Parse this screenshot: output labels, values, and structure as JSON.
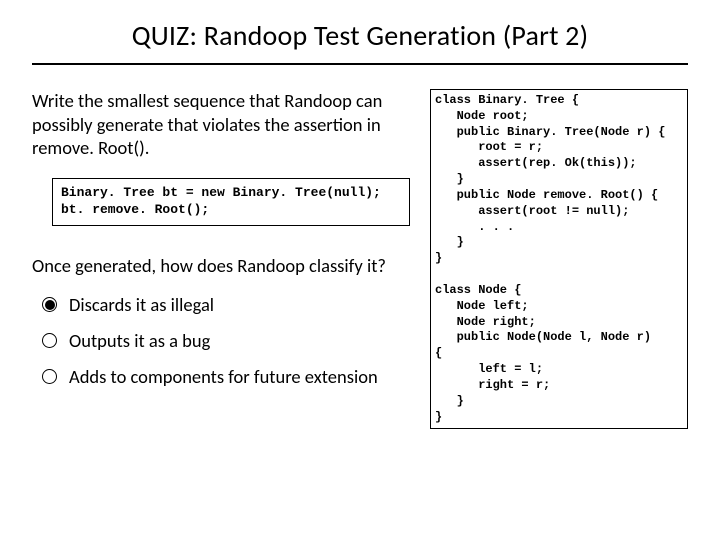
{
  "title": "QUIZ: Randoop Test Generation (Part 2)",
  "question1": "Write the smallest sequence that Randoop can possibly generate that violates the assertion in remove. Root().",
  "code_inset": "Binary. Tree bt = new Binary. Tree(null);\nbt. remove. Root();",
  "question2": "Once generated, how does Randoop classify it?",
  "options": [
    {
      "label": "Discards it as illegal",
      "selected": true
    },
    {
      "label": "Outputs it as a bug",
      "selected": false
    },
    {
      "label": "Adds to components for future extension",
      "selected": false
    }
  ],
  "code_right": "class Binary. Tree {\n   Node root;\n   public Binary. Tree(Node r) {\n      root = r;\n      assert(rep. Ok(this));\n   }\n   public Node remove. Root() {\n      assert(root != null);\n      . . .\n   }\n}\n\nclass Node {\n   Node left;\n   Node right;\n   public Node(Node l, Node r)\n{\n      left = l;\n      right = r;\n   }\n}"
}
